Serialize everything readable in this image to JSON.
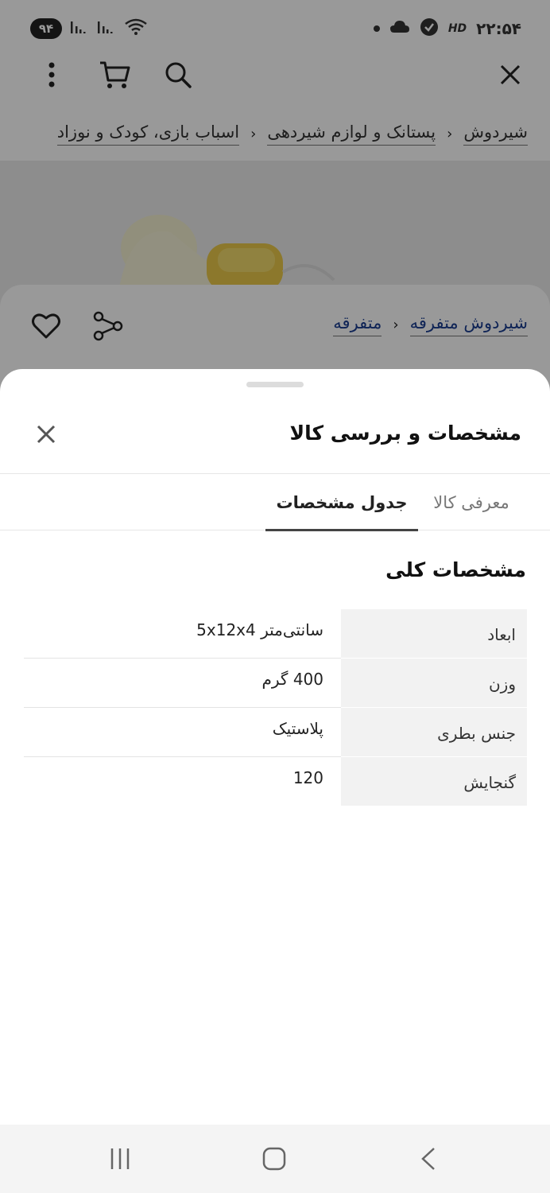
{
  "status_bar": {
    "time": "۲۲:۵۴",
    "battery": "۹۴",
    "hd": "HD",
    "icons": [
      "signal-icon",
      "signal-icon",
      "wifi-icon",
      "dot-icon",
      "cloud-icon",
      "shield-check-icon"
    ]
  },
  "toolbar": {
    "icons": [
      "more-vert-icon",
      "cart-icon",
      "search-icon",
      "close-icon"
    ]
  },
  "breadcrumb": {
    "items": [
      "اسباب بازی، کودک و نوزاد",
      "پستانک و لوازم شیردهی",
      "شیردوش"
    ]
  },
  "product": {
    "categories": [
      "متفرقه",
      "شیردوش متفرقه"
    ],
    "icons": [
      "share-icon",
      "heart-icon"
    ]
  },
  "sheet": {
    "title": "مشخصات و بررسی کالا",
    "tabs": [
      {
        "label": "معرفی کالا",
        "active": false
      },
      {
        "label": "جدول مشخصات",
        "active": true
      }
    ],
    "section_title": "مشخصات کلی",
    "specs": [
      {
        "key": "ابعاد",
        "value": "سانتی‌متر 5x12x4"
      },
      {
        "key": "وزن",
        "value": "400 گرم"
      },
      {
        "key": "جنس بطری",
        "value": "پلاستیک"
      },
      {
        "key": "گنجایش",
        "value": "120"
      }
    ]
  },
  "nav_bar": {
    "icons": [
      "recents-icon",
      "home-icon",
      "back-icon"
    ]
  },
  "colors": {
    "overlay": "#000000",
    "tab_indicator": "#444444",
    "key_cell_bg": "#f2f2f2",
    "nav_bg": "#f4f4f4"
  }
}
